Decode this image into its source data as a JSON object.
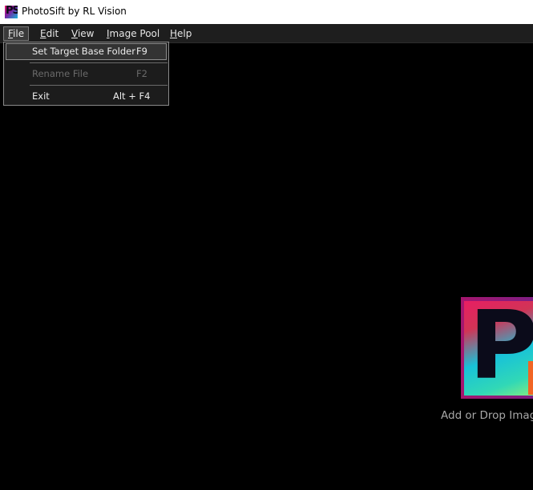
{
  "window": {
    "title": "PhotoSift by RL Vision"
  },
  "icons": {
    "app": "photosift-logo-icon",
    "logo": "photosift-large-logo"
  },
  "menubar": {
    "items": [
      {
        "label": "File",
        "mnemonic": "F",
        "rest": "ile"
      },
      {
        "label": "Edit",
        "mnemonic": "E",
        "rest": "dit"
      },
      {
        "label": "View",
        "mnemonic": "V",
        "rest": "iew"
      },
      {
        "label": "Image Pool",
        "mnemonic": "I",
        "rest": "mage Pool"
      },
      {
        "label": "Help",
        "mnemonic": "H",
        "rest": "elp"
      }
    ]
  },
  "file_menu": {
    "items": [
      {
        "label": "Set Target Base Folder",
        "shortcut": "F9",
        "enabled": true
      },
      {
        "label": "Rename File",
        "shortcut": "F2",
        "enabled": false
      },
      {
        "label": "Exit",
        "shortcut": "Alt + F4",
        "enabled": true
      }
    ]
  },
  "canvas": {
    "logo_letter": "P",
    "hint": "Add or Drop Image"
  },
  "colors": {
    "background": "#000000",
    "menubar": "#1e1e1e",
    "accent_orange": "#f26524"
  }
}
